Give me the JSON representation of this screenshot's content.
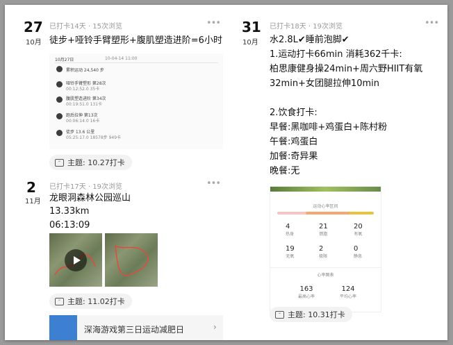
{
  "left_post_1": {
    "day": "27",
    "month": "10月",
    "meta": "已打卡14天 · 15次浏览",
    "more": "•••",
    "title": "徒步+哑铃手臂塑形+腹肌塑造进阶=6小时",
    "workout_log": {
      "date": "10月27日",
      "summary_date": "10-04-14  11:00",
      "items": [
        {
          "name": "累积运动 24,540 步",
          "sub": ""
        },
        {
          "name": "哑铃手臂塑形 第28次",
          "sub": "00:12:52.0  35卡"
        },
        {
          "name": "腹肌塑造进阶 第34次",
          "sub": "00:19:51.0  131卡"
        },
        {
          "name": "跑后拉伸 第13次",
          "sub": "00:06:14.0  16卡"
        },
        {
          "name": "徒步 13.6 公里",
          "sub": "05:25:17.0   18578步   949卡"
        }
      ]
    },
    "tag": "主题: 10.27打卡"
  },
  "left_post_2": {
    "day": "2",
    "month": "11月",
    "meta": "已打卡17天 · 19次浏览",
    "more": "•••",
    "lines": [
      "龙眼洞森林公园巡山",
      "13.33km",
      "06:13:09"
    ],
    "tag": "主题: 11.02打卡",
    "next_preview": "深海游戏第三日运动减肥日"
  },
  "right_post": {
    "day": "31",
    "month": "10月",
    "meta": "已打卡18天 · 19次浏览",
    "more": "•••",
    "lines": [
      "水2.8L✔睡前泡脚✔",
      "1.运动打卡66min 消耗362千卡:",
      "柏思康健身操24min+周六野HIIT有氧",
      "32min+女团腿拉伸10min",
      "",
      "2.饮食打卡:",
      "早餐:黑咖啡+鸡蛋白+陈村粉",
      "午餐:鸡蛋白",
      "加餐:奇异果",
      "晚餐:无"
    ],
    "heart_zone_title": "运动心率区间",
    "heart_zone_stats": [
      {
        "value": "4",
        "label": "热身"
      },
      {
        "value": "21",
        "label": "燃脂"
      },
      {
        "value": "20",
        "label": "有氧"
      },
      {
        "value": "19",
        "label": "无氧"
      },
      {
        "value": "2",
        "label": "极限"
      },
      {
        "value": "0",
        "label": "静息"
      }
    ],
    "heart_chart_title": "心率图表",
    "heart_chart_stats": [
      {
        "value": "163",
        "label": "最高心率"
      },
      {
        "value": "124",
        "label": "平均心率"
      }
    ],
    "tag": "主题: 10.31打卡"
  },
  "colors": {
    "zone_bar": [
      "#f7c3c3",
      "#f6a66e",
      "#e9c33b"
    ],
    "accent_orange": "#f08a2c",
    "map_route": "#e14b3c"
  }
}
